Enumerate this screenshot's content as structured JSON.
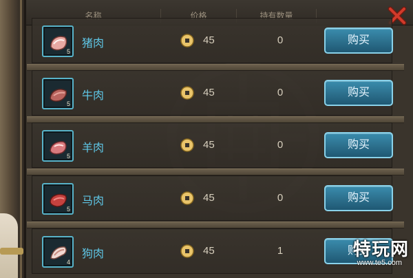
{
  "header": {
    "col_name": "名称",
    "col_price": "价格",
    "col_owned": "持有数量",
    "close_icon": "close-icon"
  },
  "items": [
    {
      "name": "猪肉",
      "count": "5",
      "price": "45",
      "owned": "0",
      "buy_label": "购买",
      "icon": "pork-icon"
    },
    {
      "name": "牛肉",
      "count": "5",
      "price": "45",
      "owned": "0",
      "buy_label": "购买",
      "icon": "beef-icon"
    },
    {
      "name": "羊肉",
      "count": "5",
      "price": "45",
      "owned": "0",
      "buy_label": "购买",
      "icon": "mutton-icon"
    },
    {
      "name": "马肉",
      "count": "5",
      "price": "45",
      "owned": "0",
      "buy_label": "购买",
      "icon": "horse-meat-icon"
    },
    {
      "name": "狗肉",
      "count": "4",
      "price": "45",
      "owned": "1",
      "buy_label": "购买",
      "icon": "dog-meat-icon"
    }
  ],
  "watermark": {
    "title": "特玩网",
    "url": "www.te5.com"
  },
  "colors": {
    "item_name": "#5fc7e7",
    "buy_button": "#2c6f8c",
    "close_red": "#d23a2a"
  }
}
